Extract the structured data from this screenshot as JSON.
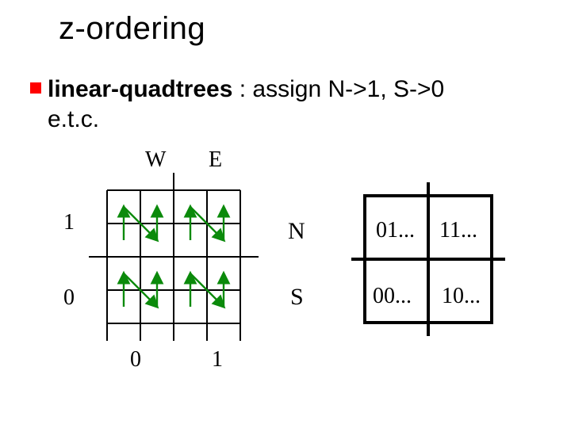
{
  "title": "z-ordering",
  "subtitle_bold": "linear-quadtrees",
  "subtitle_rest": " : assign N->1, S->0",
  "subtitle_line2": "e.t.c.",
  "labels": {
    "W": "W",
    "E": "E",
    "row1": "1",
    "row0": "0",
    "col0": "0",
    "col1": "1",
    "N": "N",
    "S": "S"
  },
  "grid2": {
    "tl": "01...",
    "tr": "11...",
    "bl": "00...",
    "br": "10..."
  },
  "chart_data": {
    "type": "table",
    "description": "Quadtree z-ordering / Morton code demonstration. 2x2 grid positions encoded by row (N=1, S=0) and column (W=0, E=1) bits producing binary prefixes.",
    "rows": [
      "N (1)",
      "S (0)"
    ],
    "cols": [
      "W (0)",
      "E (1)"
    ],
    "cells": [
      [
        "01...",
        "11..."
      ],
      [
        "00...",
        "10..."
      ]
    ],
    "axis_encoding": {
      "N": 1,
      "S": 0,
      "W": 0,
      "E": 1
    },
    "left_grid": "4x4 refinement showing recursive N-shaped (z-order) traversal arrows (green)",
    "title": "z-ordering"
  }
}
